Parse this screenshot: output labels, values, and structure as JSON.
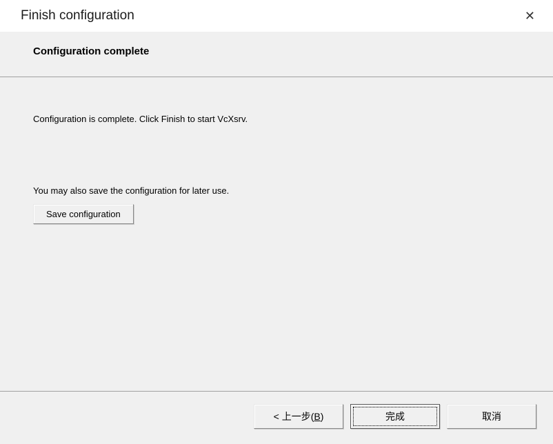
{
  "titlebar": {
    "title": "Finish configuration",
    "close_glyph": "✕"
  },
  "header": {
    "title": "Configuration complete"
  },
  "content": {
    "line1": "Configuration is complete. Click Finish to start VcXsrv.",
    "line2": "You may also save the configuration for later use.",
    "save_button": "Save configuration"
  },
  "footer": {
    "back_prefix": "< 上一步(",
    "back_mnemonic": "B",
    "back_suffix": ")",
    "finish": "完成",
    "cancel": "取消"
  }
}
